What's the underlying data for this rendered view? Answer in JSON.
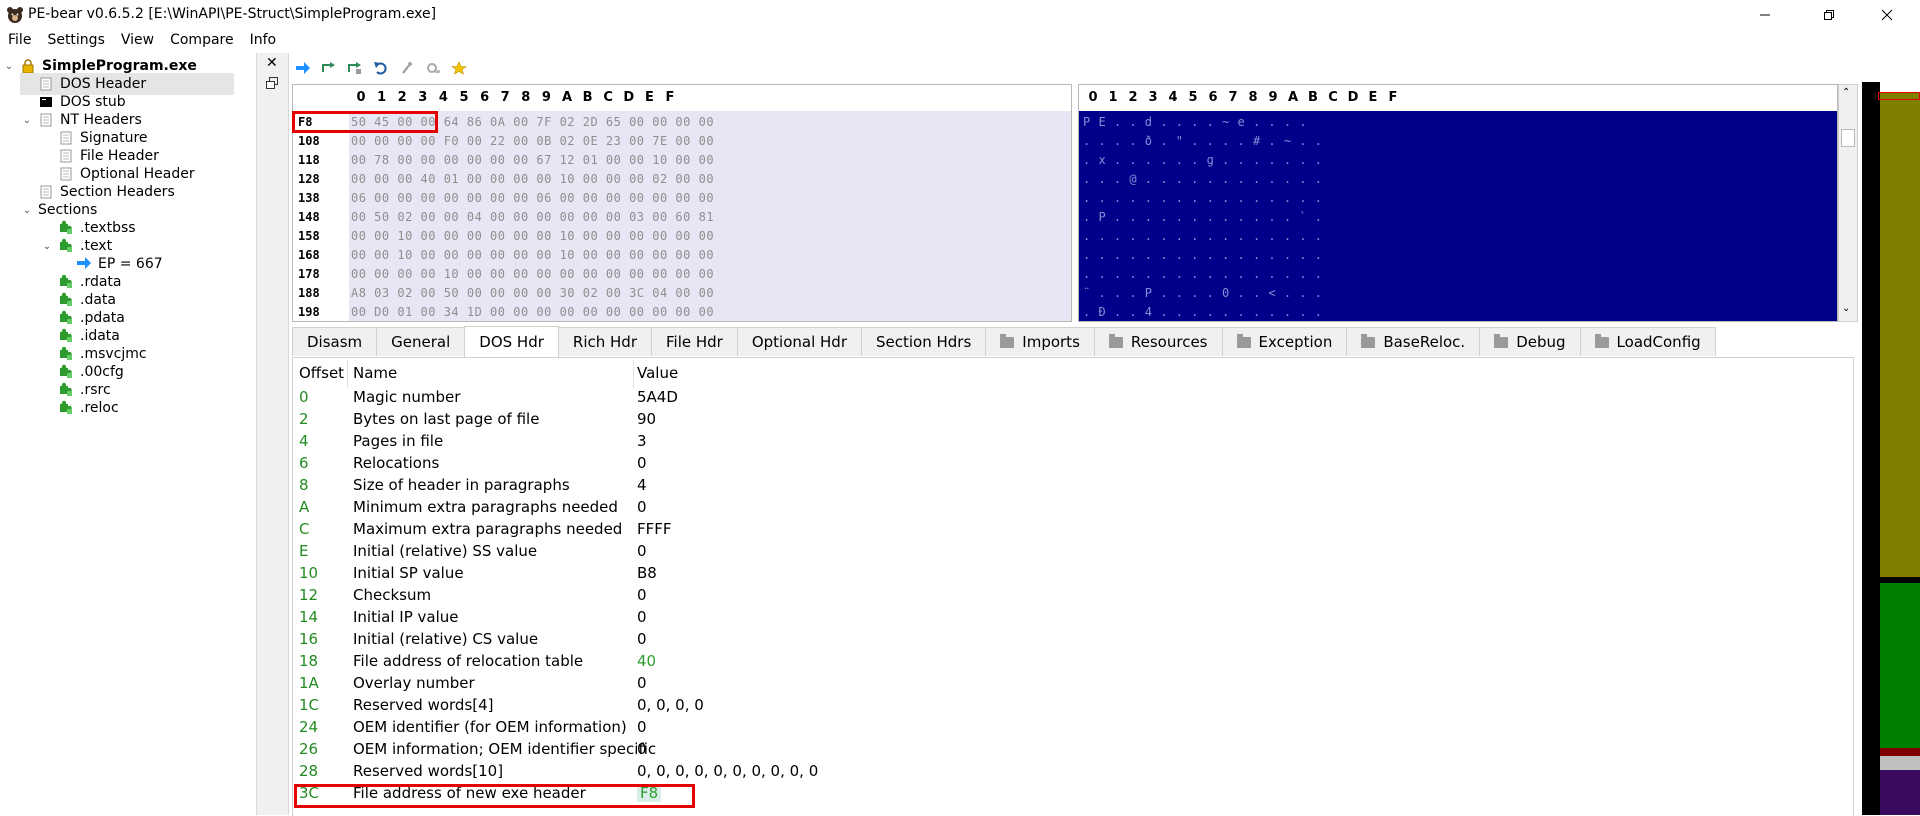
{
  "window": {
    "title": "PE-bear v0.6.5.2 [E:\\WinAPI\\PE-Struct\\SimpleProgram.exe]"
  },
  "menu": [
    "File",
    "Settings",
    "View",
    "Compare",
    "Info"
  ],
  "tree": {
    "root": "SimpleProgram.exe",
    "items": [
      {
        "label": "DOS Header",
        "level": 1,
        "selected": true
      },
      {
        "label": "DOS stub",
        "level": 1
      },
      {
        "label": "NT Headers",
        "level": 1,
        "expanded": true
      },
      {
        "label": "Signature",
        "level": 2
      },
      {
        "label": "File Header",
        "level": 2
      },
      {
        "label": "Optional Header",
        "level": 2
      },
      {
        "label": "Section Headers",
        "level": 1
      },
      {
        "label": "Sections",
        "level": 1,
        "expanded": true
      },
      {
        "label": ".textbss",
        "level": 2
      },
      {
        "label": ".text",
        "level": 2,
        "expanded": true
      },
      {
        "label": "EP = 667",
        "level": 3
      },
      {
        "label": ".rdata",
        "level": 2
      },
      {
        "label": ".data",
        "level": 2
      },
      {
        "label": ".pdata",
        "level": 2
      },
      {
        "label": ".idata",
        "level": 2
      },
      {
        "label": ".msvcjmc",
        "level": 2
      },
      {
        "label": ".00cfg",
        "level": 2
      },
      {
        "label": ".rsrc",
        "level": 2
      },
      {
        "label": ".reloc",
        "level": 2
      }
    ]
  },
  "hex": {
    "columns": [
      "0",
      "1",
      "2",
      "3",
      "4",
      "5",
      "6",
      "7",
      "8",
      "9",
      "A",
      "B",
      "C",
      "D",
      "E",
      "F"
    ],
    "rows": [
      {
        "offset": "F8",
        "bytes": "50 45 00 00 64 86 0A 00 7F 02 2D 65 00 00 00 00",
        "ascii": "P E . . d . . . . ~ e . . . ."
      },
      {
        "offset": "108",
        "bytes": "00 00 00 00 F0 00 22 00 0B 02 0E 23 00 7E 00 00",
        "ascii": ". . . . ð . \" . . . . # . ~ . ."
      },
      {
        "offset": "118",
        "bytes": "00 78 00 00 00 00 00 00 67 12 01 00 00 10 00 00",
        "ascii": ". x . . . . . . g . . . . . . ."
      },
      {
        "offset": "128",
        "bytes": "00 00 00 40 01 00 00 00 00 10 00 00 00 02 00 00",
        "ascii": ". . . @ . . . . . . . . . . . ."
      },
      {
        "offset": "138",
        "bytes": "06 00 00 00 00 00 00 00 06 00 00 00 00 00 00 00",
        "ascii": ". . . . . . . . . . . . . . . ."
      },
      {
        "offset": "148",
        "bytes": "00 50 02 00 00 04 00 00 00 00 00 00 03 00 60 81",
        "ascii": ". P . . . . . . . . . . . . ` ."
      },
      {
        "offset": "158",
        "bytes": "00 00 10 00 00 00 00 00 00 10 00 00 00 00 00 00",
        "ascii": ". . . . . . . . . . . . . . . ."
      },
      {
        "offset": "168",
        "bytes": "00 00 10 00 00 00 00 00 00 10 00 00 00 00 00 00",
        "ascii": ". . . . . . . . . . . . . . . ."
      },
      {
        "offset": "178",
        "bytes": "00 00 00 00 10 00 00 00 00 00 00 00 00 00 00 00",
        "ascii": ". . . . . . . . . . . . . . . ."
      },
      {
        "offset": "188",
        "bytes": "A8 03 02 00 50 00 00 00 00 30 02 00 3C 04 00 00",
        "ascii": "¨ . . . P . . . . 0 . . < . . ."
      },
      {
        "offset": "198",
        "bytes": "00 D0 01 00 34 1D 00 00 00 00 00 00 00 00 00 00",
        "ascii": ". Ð . . 4 . . . . . . . . . . ."
      }
    ]
  },
  "tabs": [
    {
      "label": "Disasm"
    },
    {
      "label": "General"
    },
    {
      "label": "DOS Hdr",
      "active": true
    },
    {
      "label": "Rich Hdr"
    },
    {
      "label": "File Hdr"
    },
    {
      "label": "Optional Hdr"
    },
    {
      "label": "Section Hdrs"
    },
    {
      "label": "Imports",
      "folder": true
    },
    {
      "label": "Resources",
      "folder": true
    },
    {
      "label": "Exception",
      "folder": true
    },
    {
      "label": "BaseReloc.",
      "folder": true
    },
    {
      "label": "Debug",
      "folder": true
    },
    {
      "label": "LoadConfig",
      "folder": true
    }
  ],
  "table": {
    "headers": [
      "Offset",
      "Name",
      "Value"
    ],
    "rows": [
      {
        "offset": "0",
        "name": "Magic number",
        "value": "5A4D"
      },
      {
        "offset": "2",
        "name": "Bytes on last page of file",
        "value": "90"
      },
      {
        "offset": "4",
        "name": "Pages in file",
        "value": "3"
      },
      {
        "offset": "6",
        "name": "Relocations",
        "value": "0"
      },
      {
        "offset": "8",
        "name": "Size of header in paragraphs",
        "value": "4"
      },
      {
        "offset": "A",
        "name": "Minimum extra paragraphs needed",
        "value": "0"
      },
      {
        "offset": "C",
        "name": "Maximum extra paragraphs needed",
        "value": "FFFF"
      },
      {
        "offset": "E",
        "name": "Initial (relative) SS value",
        "value": "0"
      },
      {
        "offset": "10",
        "name": "Initial SP value",
        "value": "B8"
      },
      {
        "offset": "12",
        "name": "Checksum",
        "value": "0"
      },
      {
        "offset": "14",
        "name": "Initial IP value",
        "value": "0"
      },
      {
        "offset": "16",
        "name": "Initial (relative) CS value",
        "value": "0"
      },
      {
        "offset": "18",
        "name": "File address of relocation table",
        "value": "40",
        "green": true
      },
      {
        "offset": "1A",
        "name": "Overlay number",
        "value": "0"
      },
      {
        "offset": "1C",
        "name": "Reserved words[4]",
        "value": "0, 0, 0, 0"
      },
      {
        "offset": "24",
        "name": "OEM identifier (for OEM information)",
        "value": "0"
      },
      {
        "offset": "26",
        "name": "OEM information; OEM identifier specific",
        "value": "0"
      },
      {
        "offset": "28",
        "name": "Reserved words[10]",
        "value": "0, 0, 0, 0, 0, 0, 0, 0, 0, 0"
      },
      {
        "offset": "3C",
        "name": "File address of new exe header",
        "value": "F8",
        "green": true,
        "highlighted": true
      }
    ]
  },
  "colors": {
    "hex_bg": "#e6e6f5",
    "ascii_bg": "#00008b",
    "offset_green": "#228b22",
    "highlight_red": "#e60000"
  }
}
